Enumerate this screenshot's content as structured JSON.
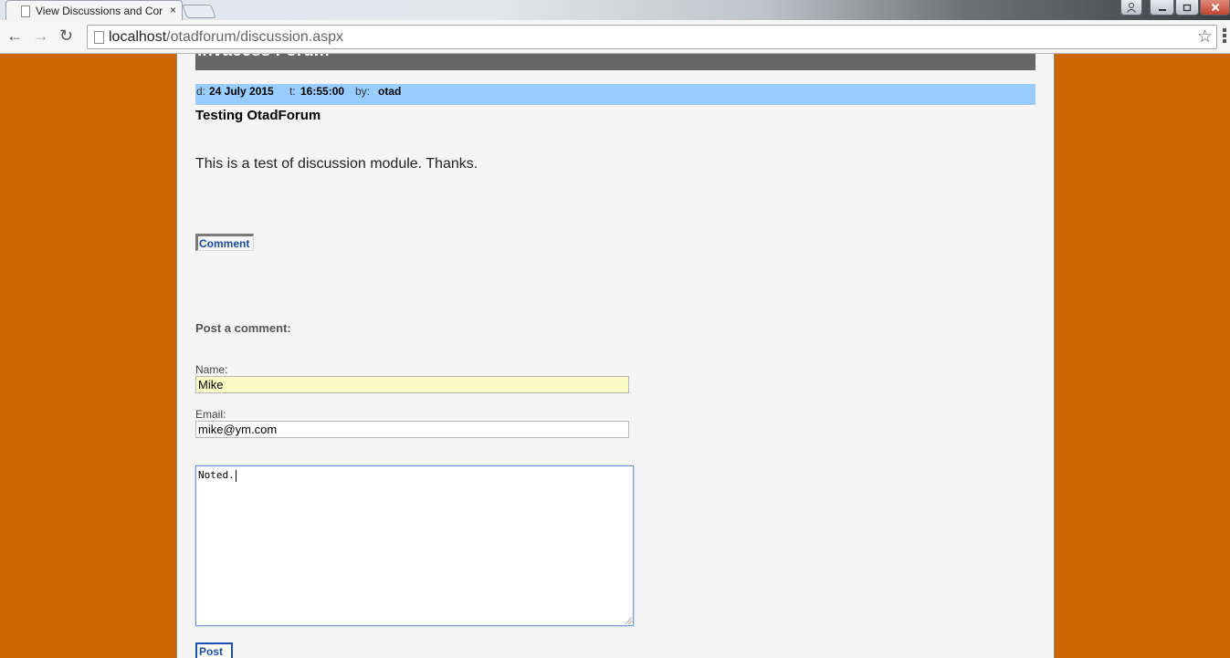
{
  "browser": {
    "tab_title": "View Discussions and Cor",
    "tab_close": "×",
    "url_host": "localhost",
    "url_path": "/otadforum/discussion.aspx",
    "back_glyph": "←",
    "forward_glyph": "→",
    "reload_glyph": "↻",
    "star_glyph": "☆",
    "icons": [
      "document-icon",
      "back-arrow-icon",
      "forward-arrow-icon",
      "reload-icon",
      "bookmark-star-icon",
      "menu-icon",
      "user-icon",
      "minimize-icon",
      "maximize-icon",
      "close-icon"
    ]
  },
  "forum": {
    "header_title": "Invacess Forum"
  },
  "topic": {
    "date_label": "d:",
    "date_value": "24 July 2015",
    "time_label": "t:",
    "time_value": "16:55:00",
    "by_label": "by:",
    "by_value": "otad",
    "title": "Testing OtadForum",
    "body": "This is a test of discussion module. Thanks.",
    "comment_button": "Comment"
  },
  "form": {
    "heading": "Post a comment:",
    "name_label": "Name:",
    "name_value": "Mike",
    "email_label": "Email:",
    "email_value": "mike@ym.com",
    "comment_value": "Noted.",
    "post_button": "Post"
  },
  "colors": {
    "page_background": "#cc6600",
    "content_background": "#f5f5f5",
    "header_bar": "#666666",
    "meta_bar": "#99ccff",
    "name_field_autofill": "#fafcc6",
    "button_text": "#1a4fa0"
  }
}
